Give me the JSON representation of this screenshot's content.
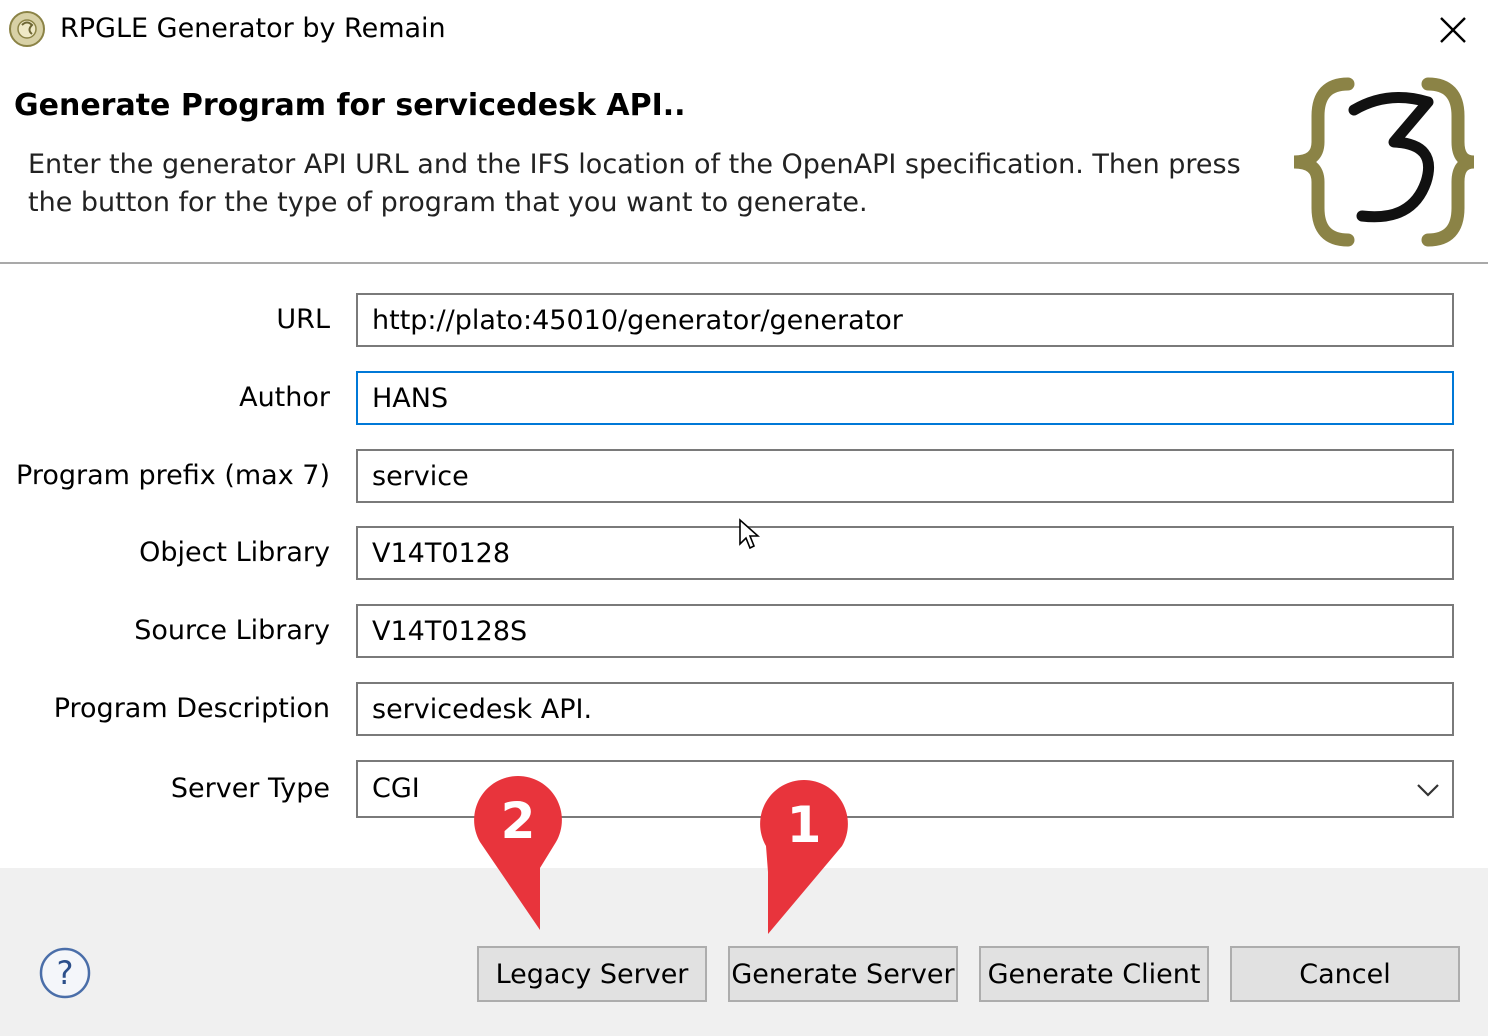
{
  "window": {
    "title": "RPGLE Generator by Remain",
    "icon": "remain-app-icon",
    "close_icon": "close-icon"
  },
  "header": {
    "title": "Generate Program for servicedesk API..",
    "description": "Enter the generator API URL and the IFS location of the OpenAPI specification. Then press the button for the type of program that you want to generate.",
    "logo_text": "{3}"
  },
  "form": {
    "url": {
      "label": "URL",
      "value": "http://plato:45010/generator/generator"
    },
    "author": {
      "label": "Author",
      "value": "HANS"
    },
    "program_prefix": {
      "label": "Program prefix (max 7)",
      "value": "service"
    },
    "object_library": {
      "label": "Object Library",
      "value": "V14T0128"
    },
    "source_library": {
      "label": "Source Library",
      "value": "V14T0128S"
    },
    "program_description": {
      "label": "Program Description",
      "value": "servicedesk API."
    },
    "server_type": {
      "label": "Server Type",
      "value": "CGI"
    }
  },
  "footer": {
    "help_icon": "help-icon",
    "buttons": {
      "legacy_server": "Legacy Server",
      "generate_server": "Generate Server",
      "generate_client": "Generate Client",
      "cancel": "Cancel"
    }
  },
  "annotations": {
    "marker_1": "1",
    "marker_2": "2",
    "color": "#e8343c"
  },
  "colors": {
    "focus_border": "#0078d7",
    "footer_bg": "#f0f0f0",
    "logo_brace": "#8b8346"
  }
}
